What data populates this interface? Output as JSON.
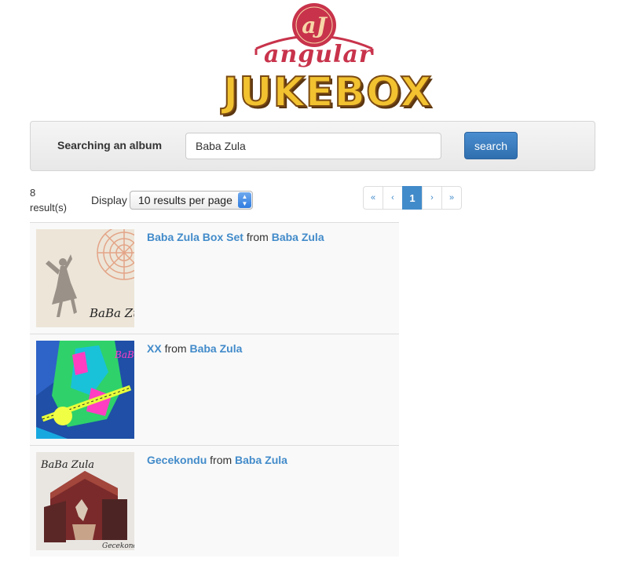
{
  "logo": {
    "badge_text": "aJ",
    "word_top": "angular",
    "word_bottom": "JUKEBOX",
    "colors": {
      "red": "#c8334b",
      "gold": "#f2c230",
      "brown": "#7a4a12"
    }
  },
  "search": {
    "label": "Searching an album",
    "value": "Baba Zula",
    "button_label": "search"
  },
  "results": {
    "count_number": "8",
    "count_suffix": "result(s)",
    "display_label": "Display",
    "per_page_selected": "10 results per page",
    "pagination": {
      "first": "«",
      "prev": "‹",
      "current": "1",
      "next": "›",
      "last": "»"
    }
  },
  "albums": [
    {
      "title": "Baba Zula Box Set",
      "from_word": "from",
      "artist": "Baba Zula",
      "cover_icon": "album-cover-dancer-image",
      "cover_text": "BaBa Zula"
    },
    {
      "title": "XX",
      "from_word": "from",
      "artist": "Baba Zula",
      "cover_icon": "album-cover-neon-guitar-image",
      "cover_text": "BaBa Zula"
    },
    {
      "title": "Gecekondu",
      "from_word": "from",
      "artist": "Baba Zula",
      "cover_icon": "album-cover-house-image",
      "cover_text": "BaBa Zula",
      "cover_caption": "Gecekondu"
    }
  ],
  "theme": {
    "link_color": "#428bca",
    "button_color": "#2f6faf"
  }
}
